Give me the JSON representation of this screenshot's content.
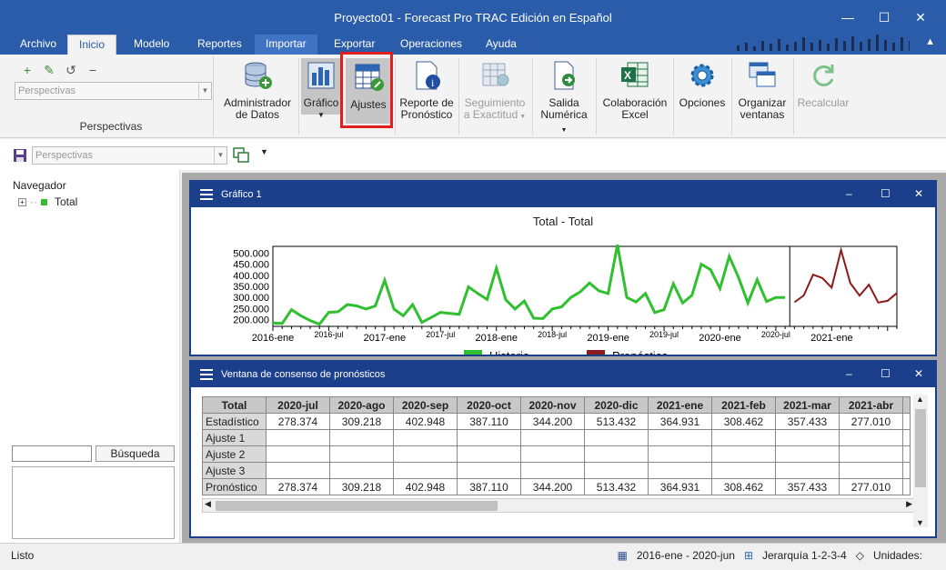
{
  "window": {
    "title": "Proyecto01 - Forecast Pro TRAC Edición en Español"
  },
  "menu": [
    {
      "label": "Archivo"
    },
    {
      "label": "Inicio"
    },
    {
      "label": "Modelo"
    },
    {
      "label": "Reportes"
    },
    {
      "label": "Importar"
    },
    {
      "label": "Exportar"
    },
    {
      "label": "Operaciones"
    },
    {
      "label": "Ayuda"
    }
  ],
  "ribbon": {
    "perspectives": {
      "combo": "Perspectivas",
      "group_label": "Perspectivas"
    },
    "buttons": {
      "admin_line1": "Administrador",
      "admin_line2": "de Datos",
      "grafico": "Gráfico",
      "ajustes": "Ajustes",
      "reporte_line1": "Reporte de",
      "reporte_line2": "Pronóstico",
      "seguimiento_line1": "Seguimiento",
      "seguimiento_line2": "a Exactitud",
      "salida_line1": "Salida",
      "salida_line2": "Numérica",
      "colab_line1": "Colaboración",
      "colab_line2": "Excel",
      "opciones": "Opciones",
      "organizar_line1": "Organizar",
      "organizar_line2": "ventanas",
      "recalcular": "Recalcular"
    }
  },
  "perspective_bar": {
    "combo": "Perspectivas"
  },
  "navigator": {
    "title": "Navegador",
    "tree_item": "Total",
    "search_button": "Búsqueda"
  },
  "chart_window": {
    "title": "Gráfico 1",
    "chart_title": "Total - Total"
  },
  "chart_data": {
    "type": "line",
    "title": "Total - Total",
    "y_ticks": [
      "500.000",
      "450.000",
      "400.000",
      "350.000",
      "300.000",
      "250.000",
      "200.000"
    ],
    "ylim": [
      170000,
      530000
    ],
    "x_major_labels": [
      "2016-ene",
      "2017-ene",
      "2018-ene",
      "2019-ene",
      "2020-ene",
      "2021-ene"
    ],
    "x_minor_labels": [
      "2016-jul",
      "2017-jul",
      "2018-jul",
      "2019-jul",
      "2020-jul"
    ],
    "legend": [
      {
        "name": "Historia",
        "color": "#2fbf2f"
      },
      {
        "name": "Pronóstico",
        "color": "#8b1a1a"
      }
    ],
    "series": [
      {
        "name": "Historia",
        "color": "#2fbf2f",
        "values": [
          185000,
          183000,
          245000,
          218000,
          196000,
          180000,
          233000,
          236000,
          268000,
          262000,
          248000,
          262000,
          378000,
          248000,
          218000,
          268000,
          188000,
          210000,
          233000,
          228000,
          224000,
          348000,
          318000,
          291000,
          432000,
          290000,
          248000,
          284000,
          207000,
          205000,
          248000,
          258000,
          300000,
          325000,
          365000,
          330000,
          318000,
          537000,
          300000,
          280000,
          318000,
          232000,
          245000,
          362000,
          275000,
          310000,
          450000,
          425000,
          340000,
          485000,
          390000,
          275000,
          380000,
          282000,
          300000,
          300000
        ]
      },
      {
        "name": "Pronóstico",
        "color": "#8b1a1a",
        "values": [
          278374,
          309218,
          402948,
          387110,
          344200,
          513432,
          364931,
          308462,
          357433,
          277010,
          285000,
          320000
        ]
      }
    ]
  },
  "consensus_window": {
    "title": "Ventana de consenso de pronósticos",
    "corner": "Total",
    "columns": [
      "2020-jul",
      "2020-ago",
      "2020-sep",
      "2020-oct",
      "2020-nov",
      "2020-dic",
      "2021-ene",
      "2021-feb",
      "2021-mar",
      "2021-abr"
    ],
    "rows": [
      {
        "label": "Estadístico",
        "values": [
          "278.374",
          "309.218",
          "402.948",
          "387.110",
          "344.200",
          "513.432",
          "364.931",
          "308.462",
          "357.433",
          "277.010"
        ]
      },
      {
        "label": "Ajuste 1",
        "values": [
          "",
          "",
          "",
          "",
          "",
          "",
          "",
          "",
          "",
          ""
        ]
      },
      {
        "label": "Ajuste 2",
        "values": [
          "",
          "",
          "",
          "",
          "",
          "",
          "",
          "",
          "",
          ""
        ]
      },
      {
        "label": "Ajuste 3",
        "values": [
          "",
          "",
          "",
          "",
          "",
          "",
          "",
          "",
          "",
          ""
        ]
      },
      {
        "label": "Pronóstico",
        "values": [
          "278.374",
          "309.218",
          "402.948",
          "387.110",
          "344.200",
          "513.432",
          "364.931",
          "308.462",
          "357.433",
          "277.010"
        ]
      }
    ]
  },
  "status_bar": {
    "status": "Listo",
    "date_range": "2016-ene - 2020-jun",
    "hierarchy": "Jerarquía 1-2-3-4",
    "units": "Unidades:"
  }
}
